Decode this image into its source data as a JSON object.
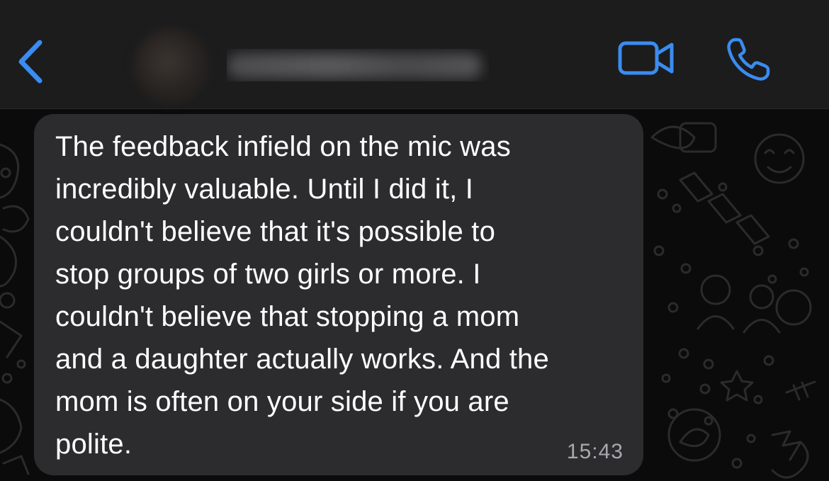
{
  "header": {
    "contact_name": "",
    "accent_color": "#3a8cf0",
    "icons": {
      "back": "chevron-left-icon",
      "video": "video-camera-icon",
      "call": "phone-icon"
    }
  },
  "chat": {
    "message": {
      "text": "The feedback infield on the mic was\nincredibly valuable. Until I did it, I\ncouldn't believe that it's possible to\nstop groups of two girls or more. I\ncouldn't believe that stopping a mom\nand a daughter actually works. And the\nmom is often on your side if you are\npolite.",
      "time": "15:43",
      "bubble_color": "#2c2c2e"
    }
  }
}
